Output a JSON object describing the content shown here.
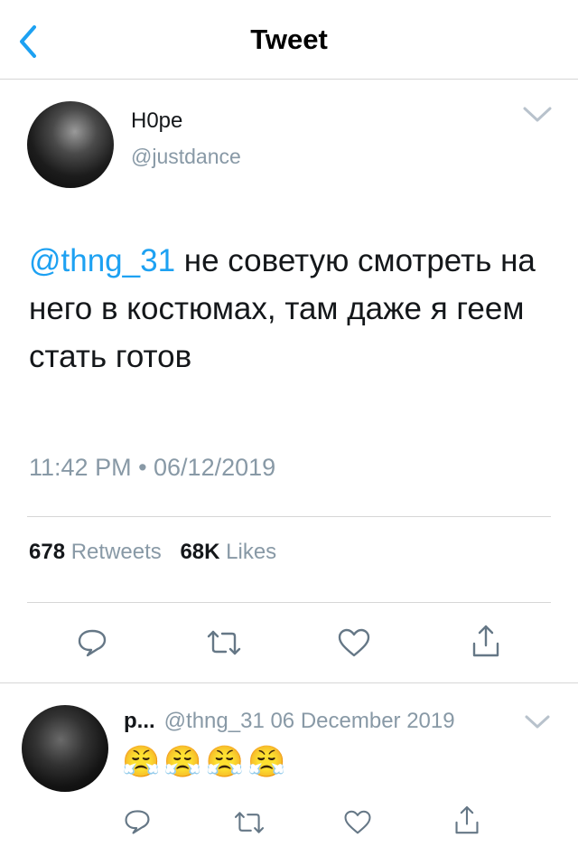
{
  "navbar": {
    "title": "Tweet"
  },
  "tweet": {
    "display_name": "H0pe",
    "handle": "@justdance",
    "mention": "@thng_31",
    "text": " не советую смотреть на него в костюмах, там даже я геем стать готов",
    "timestamp": "11:42 PM • 06/12/2019",
    "retweets_count": "678",
    "retweets_label": "Retweets",
    "likes_count": "68K",
    "likes_label": "Likes"
  },
  "reply": {
    "name": "p...",
    "meta": "@thng_31 06 December 2019",
    "text": "😤😤😤😤"
  },
  "icons": [
    "back-icon",
    "chevron-down-icon",
    "reply-icon",
    "retweet-icon",
    "like-icon",
    "share-icon"
  ],
  "colors": {
    "accent": "#1da1f2",
    "secondary_text": "#8899a6",
    "divider": "#d6d6d6"
  }
}
